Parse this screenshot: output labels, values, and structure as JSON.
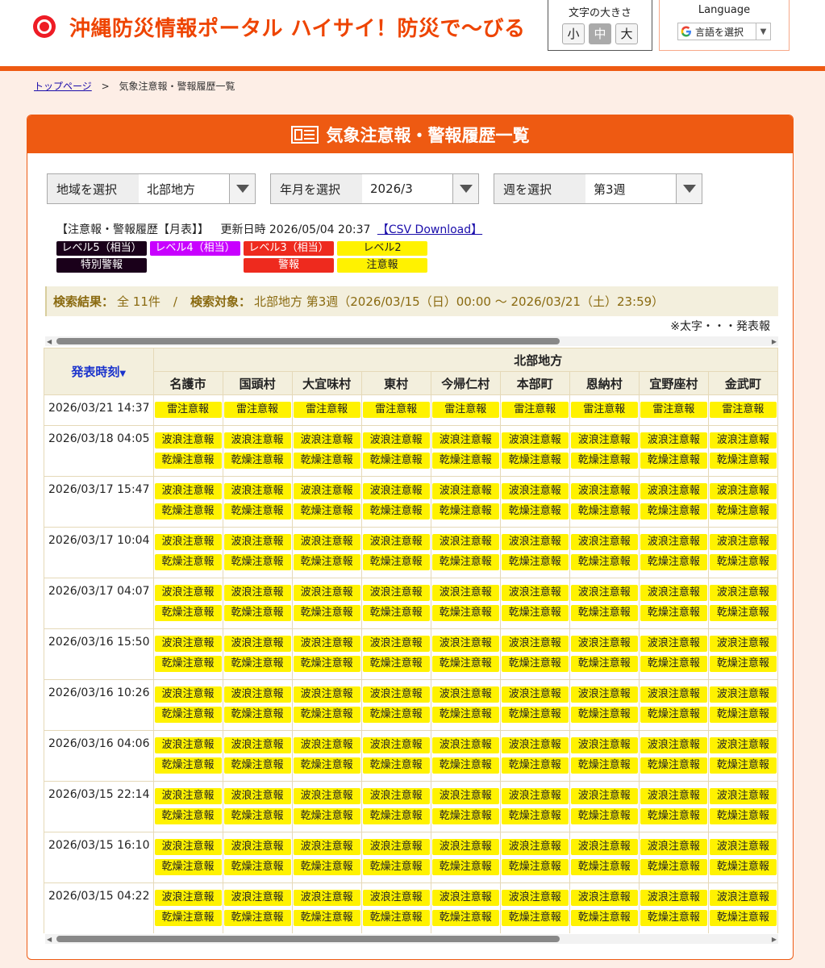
{
  "header": {
    "site_title": "沖縄防災情報ポータル ハイサイ！防災で〜びる",
    "fontsize_label": "文字の大きさ",
    "fontsize_buttons": [
      "小",
      "中",
      "大"
    ],
    "language_label": "Language",
    "language_select": "言語を選択"
  },
  "breadcrumb": {
    "home": "トップページ",
    "separator": ">",
    "current": "気象注意報・警報履歴一覧"
  },
  "panel": {
    "title": "気象注意報・警報履歴一覧"
  },
  "selectors": [
    {
      "label": "地域を選択",
      "value": "北部地方"
    },
    {
      "label": "年月を選択",
      "value": "2026/3"
    },
    {
      "label": "週を選択",
      "value": "第3週"
    }
  ],
  "history": {
    "label": "【注意報・警報履歴【月表】】",
    "updated": "更新日時 2026/05/04 20:37",
    "csv_link": "【CSV Download】"
  },
  "legend": {
    "level5": "レベル5（相当）",
    "level4": "レベル4（相当）",
    "level3": "レベル3（相当）",
    "level2": "レベル2",
    "special": "特別警報",
    "keiho": "警報",
    "chuiho": "注意報"
  },
  "result": {
    "count_label": "検索結果：",
    "count_value": "全 11件",
    "slash": "/",
    "target_label": "検索対象：",
    "target_value": "北部地方 第3週（2026/03/15（日）00:00 〜 2026/03/21（土）23:59）"
  },
  "note": "※太字・・・発表報",
  "table": {
    "sort_header": "発表時刻",
    "region": "北部地方",
    "columns": [
      "名護市",
      "国頭村",
      "大宜味村",
      "東村",
      "今帰仁村",
      "本部町",
      "恩納村",
      "宜野座村",
      "金武町"
    ],
    "rows": [
      {
        "time": "2026/03/21 14:37",
        "warnings": [
          "雷注意報"
        ]
      },
      {
        "time": "2026/03/18 04:05",
        "warnings": [
          "波浪注意報",
          "乾燥注意報"
        ]
      },
      {
        "time": "2026/03/17 15:47",
        "warnings": [
          "波浪注意報",
          "乾燥注意報"
        ]
      },
      {
        "time": "2026/03/17 10:04",
        "warnings": [
          "波浪注意報",
          "乾燥注意報"
        ]
      },
      {
        "time": "2026/03/17 04:07",
        "warnings": [
          "波浪注意報",
          "乾燥注意報"
        ]
      },
      {
        "time": "2026/03/16 15:50",
        "warnings": [
          "波浪注意報",
          "乾燥注意報"
        ]
      },
      {
        "time": "2026/03/16 10:26",
        "warnings": [
          "波浪注意報",
          "乾燥注意報"
        ]
      },
      {
        "time": "2026/03/16 04:06",
        "warnings": [
          "波浪注意報",
          "乾燥注意報"
        ]
      },
      {
        "time": "2026/03/15 22:14",
        "warnings": [
          "波浪注意報",
          "乾燥注意報"
        ]
      },
      {
        "time": "2026/03/15 16:10",
        "warnings": [
          "波浪注意報",
          "乾燥注意報"
        ]
      },
      {
        "time": "2026/03/15 04:22",
        "warnings": [
          "波浪注意報",
          "乾燥注意報"
        ]
      }
    ]
  },
  "colors": {
    "brand_orange": "#ee5a12",
    "chuiho_yellow": "#fff200",
    "keiho_red": "#ee2a1e",
    "level4_purple": "#c800ff",
    "level5_black": "#1a001a"
  }
}
